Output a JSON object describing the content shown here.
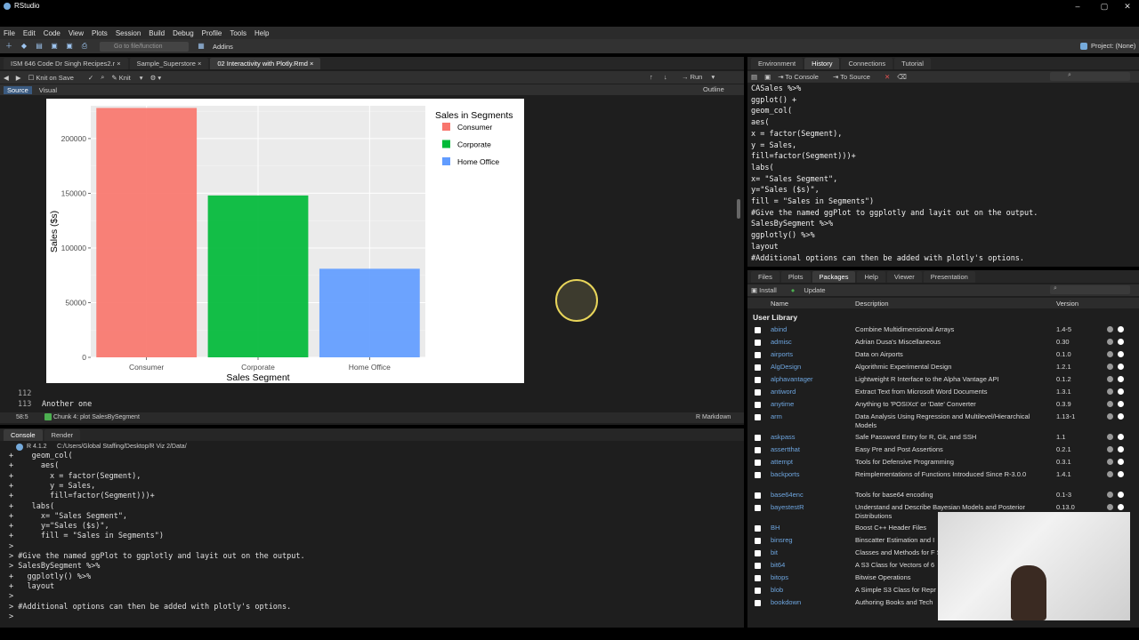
{
  "app": {
    "title": "RStudio",
    "project": "Project: (None)"
  },
  "menu": [
    "File",
    "Edit",
    "Code",
    "View",
    "Plots",
    "Session",
    "Build",
    "Debug",
    "Profile",
    "Tools",
    "Help"
  ],
  "toolbar": {
    "goto_placeholder": "Go to file/function",
    "addins": "Addins"
  },
  "editor": {
    "tabs": [
      "ISM 646 Code Dr Singh Recipes2.r",
      "Sample_Superstore",
      "02 Interactivity with Plotly.Rmd"
    ],
    "run_label": "Run",
    "knit_on_save": "Knit on Save",
    "knit": "Knit",
    "source_tab": "Source",
    "visual_tab": "Visual",
    "outline": "Outline",
    "lines": [
      {
        "num": "112",
        "text": ""
      },
      {
        "num": "113",
        "text": "Another one"
      }
    ],
    "status_pos": "58:5",
    "status_chunk": "Chunk 4: plot SalesBySegment",
    "status_lang": "R Markdown"
  },
  "chart_data": {
    "type": "bar",
    "categories": [
      "Consumer",
      "Corporate",
      "Home Office"
    ],
    "values": [
      228000,
      148000,
      81000
    ],
    "colors": [
      "#f8766d",
      "#00ba38",
      "#619cff"
    ],
    "xlabel": "Sales Segment",
    "ylabel": "Sales ($s)",
    "ylim": [
      0,
      230000
    ],
    "yticks": [
      0,
      50000,
      100000,
      150000,
      200000
    ],
    "ytick_labels": [
      "0",
      "50000",
      "100000",
      "150000",
      "200000"
    ],
    "legend_title": "Sales in Segments",
    "legend_items": [
      "Consumer",
      "Corporate",
      "Home Office"
    ],
    "legend_position": "right",
    "grid": true
  },
  "console": {
    "tabs": [
      "Console",
      "Render"
    ],
    "version": "R 4.1.2",
    "path": "C:/Users/Global Staffing/Desktop/R Viz 2/Data/",
    "lines": [
      "+    geom_col(",
      "+      aes(",
      "+        x = factor(Segment),",
      "+        y = Sales,",
      "+        fill=factor(Segment)))+",
      "+    labs(",
      "+      x= \"Sales Segment\",",
      "+      y=\"Sales ($s)\",",
      "+      fill = \"Sales in Segments\")",
      ">",
      "> #Give the named ggPlot to ggplotly and layit out on the output.",
      "> SalesBySegment %>%",
      "+   ggplotly() %>%",
      "+   layout",
      ">",
      "> #Additional options can then be added with plotly's options.",
      ">"
    ]
  },
  "history": {
    "tabs": [
      "Environment",
      "History",
      "Connections",
      "Tutorial"
    ],
    "to_console": "To Console",
    "to_source": "To Source",
    "lines": [
      "CASales %>%",
      "ggplot() +",
      "geom_col(",
      "aes(",
      "x = factor(Segment),",
      "y = Sales,",
      "fill=factor(Segment)))+",
      "labs(",
      "x= \"Sales Segment\",",
      "y=\"Sales ($s)\",",
      "fill = \"Sales in Segments\")",
      "#Give the named ggPlot to ggplotly and layit out on the output.",
      "SalesBySegment %>%",
      "ggplotly() %>%",
      "layout",
      "#Additional options can then be added with plotly's options."
    ]
  },
  "packages": {
    "tabs": [
      "Files",
      "Plots",
      "Packages",
      "Help",
      "Viewer",
      "Presentation"
    ],
    "install": "Install",
    "update": "Update",
    "col_name": "Name",
    "col_desc": "Description",
    "col_version": "Version",
    "section": "User Library",
    "rows": [
      {
        "name": "abind",
        "desc": "Combine Multidimensional Arrays",
        "ver": "1.4-5"
      },
      {
        "name": "admisc",
        "desc": "Adrian Dusa's Miscellaneous",
        "ver": "0.30"
      },
      {
        "name": "airports",
        "desc": "Data on Airports",
        "ver": "0.1.0"
      },
      {
        "name": "AlgDesign",
        "desc": "Algorithmic Experimental Design",
        "ver": "1.2.1"
      },
      {
        "name": "alphavantager",
        "desc": "Lightweight R Interface to the Alpha Vantage API",
        "ver": "0.1.2"
      },
      {
        "name": "antiword",
        "desc": "Extract Text from Microsoft Word Documents",
        "ver": "1.3.1"
      },
      {
        "name": "anytime",
        "desc": "Anything to 'POSIXct' or 'Date' Converter",
        "ver": "0.3.9"
      },
      {
        "name": "arm",
        "desc": "Data Analysis Using Regression and Multilevel/Hierarchical Models",
        "ver": "1.13-1"
      },
      {
        "name": "askpass",
        "desc": "Safe Password Entry for R, Git, and SSH",
        "ver": "1.1"
      },
      {
        "name": "assertthat",
        "desc": "Easy Pre and Post Assertions",
        "ver": "0.2.1"
      },
      {
        "name": "attempt",
        "desc": "Tools for Defensive Programming",
        "ver": "0.3.1"
      },
      {
        "name": "backports",
        "desc": "Reimplementations of Functions Introduced Since R-3.0.0",
        "ver": "1.4.1"
      },
      {
        "name": "base64enc",
        "desc": "Tools for base64 encoding",
        "ver": "0.1-3"
      },
      {
        "name": "bayestestR",
        "desc": "Understand and Describe Bayesian Models and Posterior Distributions",
        "ver": "0.13.0"
      },
      {
        "name": "BH",
        "desc": "Boost C++ Header Files",
        "ver": ""
      },
      {
        "name": "binsreg",
        "desc": "Binscatter Estimation and I",
        "ver": ""
      },
      {
        "name": "bit",
        "desc": "Classes and Methods for F Selections",
        "ver": ""
      },
      {
        "name": "bit64",
        "desc": "A S3 Class for Vectors of 6",
        "ver": ""
      },
      {
        "name": "bitops",
        "desc": "Bitwise Operations",
        "ver": ""
      },
      {
        "name": "blob",
        "desc": "A Simple S3 Class for Repr ('BLOBS')",
        "ver": ""
      },
      {
        "name": "bookdown",
        "desc": "Authoring Books and Tech",
        "ver": ""
      }
    ]
  }
}
